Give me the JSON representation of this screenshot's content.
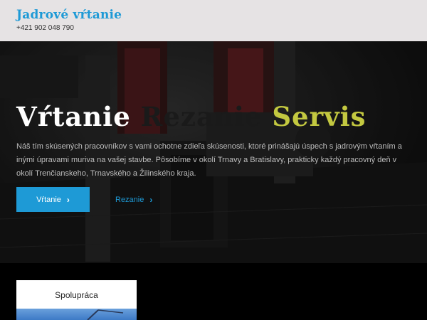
{
  "header": {
    "site_title": "Jadrové vŕtanie",
    "phone": "+421 902 048 790"
  },
  "hero": {
    "title_words": [
      "Vŕtanie",
      "Rezanie",
      "Servis"
    ],
    "description": "Náš tím skúsených pracovníkov s vami ochotne zdieľa skúsenosti, ktoré prinášajú úspech s jadrovým vŕtaním a inými úpravami muriva na vašej stavbe. Pôsobíme v okolí Trnavy a Bratislavy, prakticky každý pracovný deň v okolí Trenčianskeho, Trnavského a Žilinského kraja.",
    "primary_button": "Vŕtanie",
    "secondary_link": "Rezanie"
  },
  "cards": [
    {
      "title": "Spolupráca"
    }
  ],
  "colors": {
    "brand": "#1e9ad6",
    "accent_yellow": "#c3c840",
    "header_bg": "#e6e3e4"
  },
  "icons": {
    "chevron": "chevron-right-icon"
  }
}
